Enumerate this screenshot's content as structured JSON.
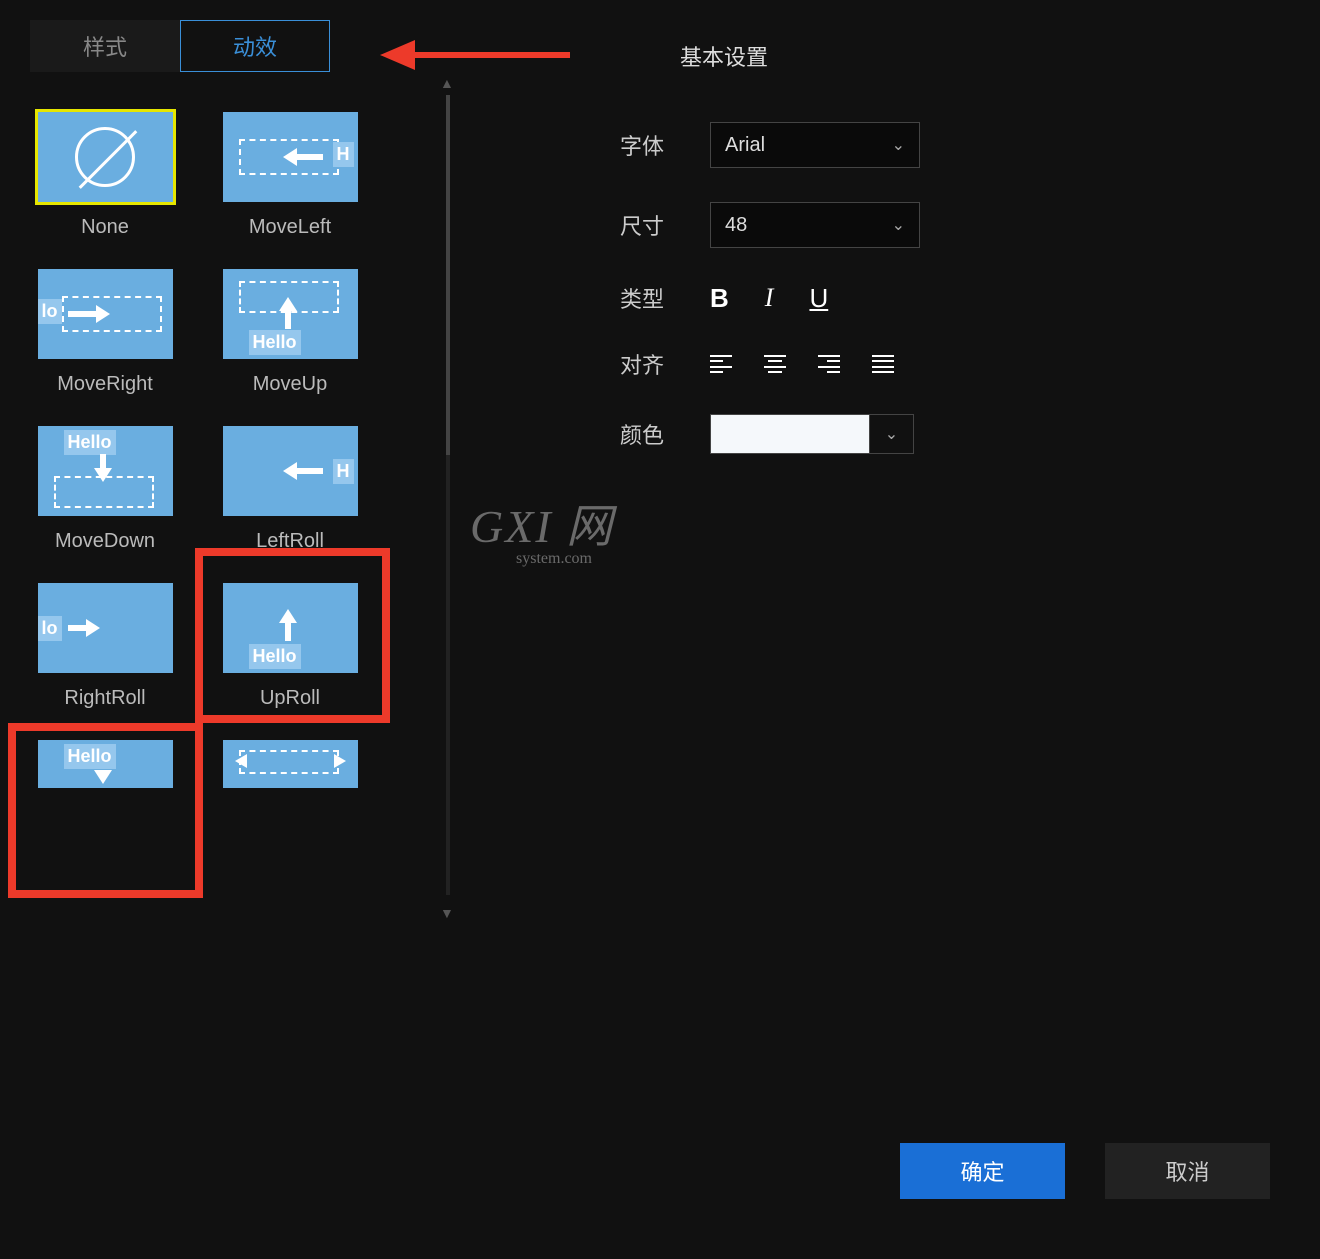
{
  "tabs": {
    "style": "样式",
    "effect": "动效"
  },
  "effects": [
    {
      "name": "None"
    },
    {
      "name": "MoveLeft"
    },
    {
      "name": "MoveRight"
    },
    {
      "name": "MoveUp"
    },
    {
      "name": "MoveDown"
    },
    {
      "name": "LeftRoll"
    },
    {
      "name": "RightRoll"
    },
    {
      "name": "UpRoll"
    }
  ],
  "settings": {
    "title": "基本设置",
    "font_label": "字体",
    "font_value": "Arial",
    "size_label": "尺寸",
    "size_value": "48",
    "type_label": "类型",
    "bold": "B",
    "italic": "I",
    "underline": "U",
    "align_label": "对齐",
    "color_label": "颜色",
    "color_value": "#f5f8fb"
  },
  "buttons": {
    "ok": "确定",
    "cancel": "取消"
  },
  "watermark": {
    "main": "GXI 网",
    "sub": "system.com"
  },
  "hello_text": "Hello"
}
